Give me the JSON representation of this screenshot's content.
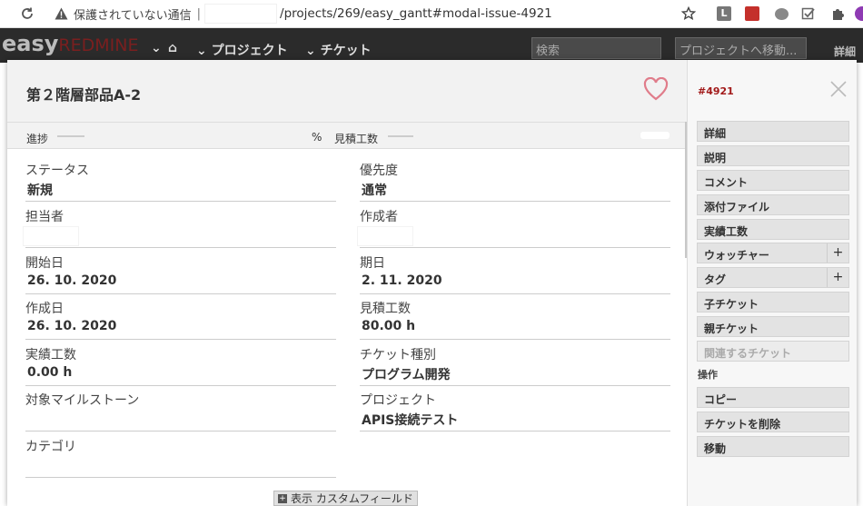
{
  "browser": {
    "security_text": "保護されていない通信",
    "separator": "|",
    "url_path": "/projects/269/easy_gantt#modal-issue-4921"
  },
  "app": {
    "logo_easy": "easy",
    "logo_redmine": "REDMINE",
    "nav_projects": "プロジェクト",
    "nav_issues": "チケット",
    "search_placeholder": "検索",
    "project_jump": "プロジェクトへ移動...",
    "details_link": "詳細"
  },
  "modal": {
    "title": "第２階層部品A-2",
    "progress_label": "進捗",
    "progress_unit": "%",
    "estimate_label": "見積工数",
    "fields": {
      "status": {
        "label": "ステータス",
        "value": "新規"
      },
      "priority": {
        "label": "優先度",
        "value": "通常"
      },
      "assignee": {
        "label": "担当者",
        "value": ""
      },
      "author": {
        "label": "作成者",
        "value": ""
      },
      "start_date": {
        "label": "開始日",
        "value": "26. 10. 2020"
      },
      "due_date": {
        "label": "期日",
        "value": "2. 11. 2020"
      },
      "created_on": {
        "label": "作成日",
        "value": "26. 10. 2020"
      },
      "estimated_hours": {
        "label": "見積工数",
        "value": "80.00 h"
      },
      "spent_time": {
        "label": "実績工数",
        "value": "0.00 h"
      },
      "tracker": {
        "label": "チケット種別",
        "value": "プログラム開発"
      },
      "milestone": {
        "label": "対象マイルストーン",
        "value": ""
      },
      "project": {
        "label": "プロジェクト",
        "value": "APIS接続テスト"
      },
      "category": {
        "label": "カテゴリ",
        "value": ""
      }
    },
    "custom_fields_button": "表示 カスタムフィールド"
  },
  "sidebar": {
    "issue_id": "#4921",
    "buttons": [
      {
        "label": "詳細"
      },
      {
        "label": "説明"
      },
      {
        "label": "コメント"
      },
      {
        "label": "添付ファイル"
      },
      {
        "label": "実績工数"
      },
      {
        "label": "ウォッチャー"
      },
      {
        "label": "タグ"
      },
      {
        "label": "子チケット"
      },
      {
        "label": "親チケット"
      },
      {
        "label": "関連するチケット"
      }
    ],
    "actions_heading": "操作",
    "actions": [
      {
        "label": "コピー"
      },
      {
        "label": "チケットを削除"
      },
      {
        "label": "移動"
      }
    ]
  },
  "colors": {
    "accent_red": "#a21a1a",
    "heart": "#e07c8a"
  }
}
